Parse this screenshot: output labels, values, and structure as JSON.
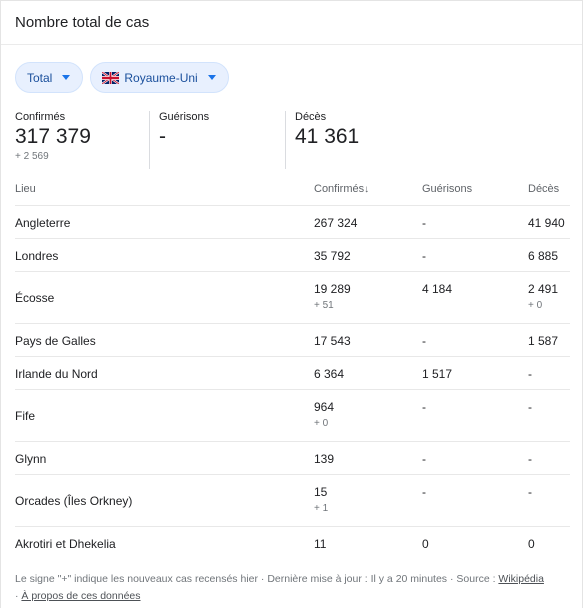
{
  "header": {
    "title": "Nombre total de cas"
  },
  "filters": {
    "metric": "Total",
    "region": "Royaume-Uni"
  },
  "stats": {
    "confirmed": {
      "label": "Confirmés",
      "value": "317 379",
      "delta": "+ 2 569"
    },
    "recovered": {
      "label": "Guérisons",
      "value": "-"
    },
    "deaths": {
      "label": "Décès",
      "value": "41 361"
    }
  },
  "table": {
    "headers": {
      "place": "Lieu",
      "confirmed": "Confirmés",
      "recovered": "Guérisons",
      "deaths": "Décès"
    },
    "rows": [
      {
        "place": "Angleterre",
        "confirmed": "267 324",
        "recovered": "-",
        "deaths": "41 940"
      },
      {
        "place": "Londres",
        "confirmed": "35 792",
        "recovered": "-",
        "deaths": "6 885"
      },
      {
        "place": "Écosse",
        "confirmed": "19 289",
        "confirmed_delta": "+ 51",
        "recovered": "4 184",
        "deaths": "2 491",
        "deaths_delta": "+ 0"
      },
      {
        "place": "Pays de Galles",
        "confirmed": "17 543",
        "recovered": "-",
        "deaths": "1 587"
      },
      {
        "place": "Irlande du Nord",
        "confirmed": "6 364",
        "recovered": "1 517",
        "deaths": "-"
      },
      {
        "place": "Fife",
        "confirmed": "964",
        "confirmed_delta": "+ 0",
        "recovered": "-",
        "deaths": "-"
      },
      {
        "place": "Glynn",
        "confirmed": "139",
        "recovered": "-",
        "deaths": "-"
      },
      {
        "place": "Orcades (Îles Orkney)",
        "confirmed": "15",
        "confirmed_delta": "+ 1",
        "recovered": "-",
        "deaths": "-"
      },
      {
        "place": "Akrotiri et Dhekelia",
        "confirmed": "11",
        "recovered": "0",
        "deaths": "0"
      }
    ]
  },
  "footer": {
    "note": "Le signe \"+\" indique les nouveaux cas recensés hier · Dernière mise à jour : Il y a 20 minutes · Source : ",
    "source_link": "Wikipédia",
    "about_prefix": " · ",
    "about_link": "À propos de ces données"
  }
}
